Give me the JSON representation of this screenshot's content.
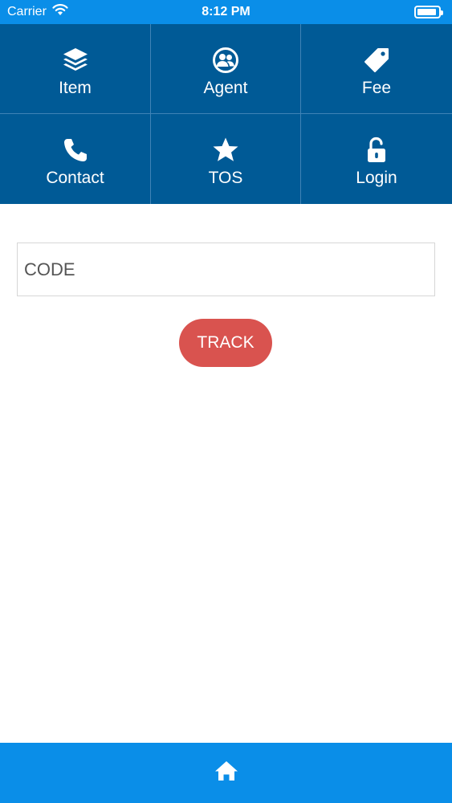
{
  "status_bar": {
    "carrier": "Carrier",
    "time": "8:12 PM",
    "battery_level": 0.9
  },
  "menu": [
    {
      "label": "Item",
      "icon": "layers-icon"
    },
    {
      "label": "Agent",
      "icon": "users-circle-icon"
    },
    {
      "label": "Fee",
      "icon": "tag-icon"
    },
    {
      "label": "Contact",
      "icon": "phone-icon"
    },
    {
      "label": "TOS",
      "icon": "star-icon"
    },
    {
      "label": "Login",
      "icon": "unlock-icon"
    }
  ],
  "form": {
    "code_placeholder": "CODE",
    "code_value": "",
    "track_label": "TRACK"
  },
  "bottom_bar": {
    "home_icon": "home-icon"
  },
  "colors": {
    "status_bar": "#0a8ee8",
    "menu_background": "#005a96",
    "menu_divider": "#3f83b6",
    "track_button": "#d9534f",
    "bottom_bar": "#0a8ee8"
  }
}
